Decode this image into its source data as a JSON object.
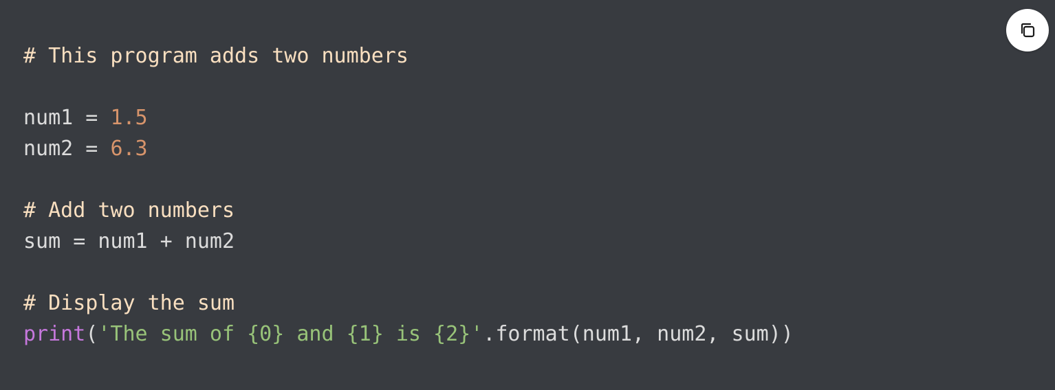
{
  "code": {
    "lines": [
      {
        "comment": "# This program adds two numbers"
      },
      {},
      {
        "var": "num1",
        "op": " = ",
        "num": "1.5"
      },
      {
        "var": "num2",
        "op": " = ",
        "num": "6.3"
      },
      {},
      {
        "comment": "# Add two numbers"
      },
      {
        "text": "sum = num1 + num2"
      },
      {},
      {
        "comment": "# Display the sum"
      },
      {
        "keyword": "print",
        "open": "(",
        "string": "'The sum of {0} and {1} is {2}'",
        "rest": ".format(num1, num2, sum))"
      }
    ]
  },
  "copy_button": {
    "icon": "copy-icon"
  },
  "colors": {
    "background": "#383b40",
    "comment": "#f9dfc0",
    "number": "#d7946b",
    "keyword": "#c678dd",
    "string": "#98c379",
    "text": "#dcdcdc"
  }
}
